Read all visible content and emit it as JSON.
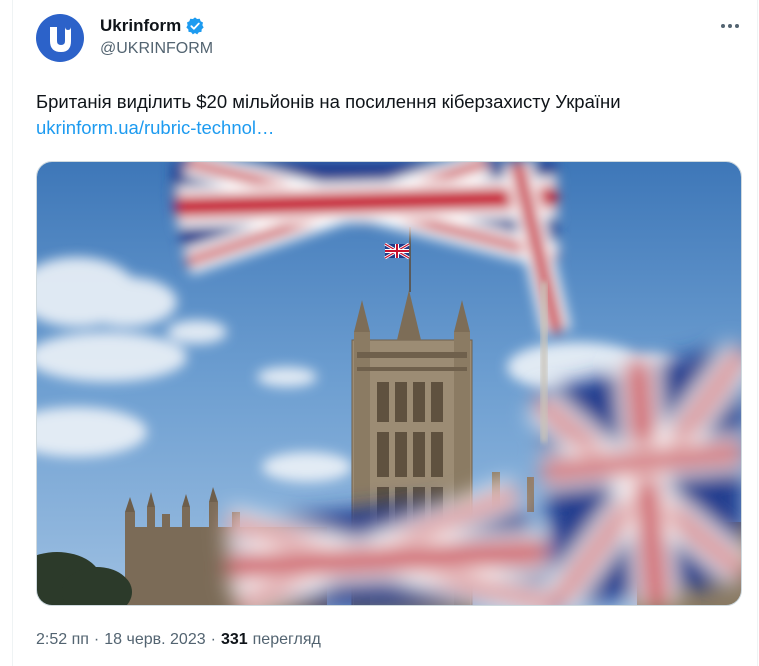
{
  "tweet": {
    "author": {
      "display_name": "Ukrinform",
      "handle": "@UKRINFORM",
      "verified": true,
      "avatar_letter": "U",
      "avatar_color": "#2c62c9"
    },
    "text": "Британія виділить $20 мільйонів на посилення кіберзахисту України",
    "link_text": "ukrinform.ua/rubric-technol…",
    "link_color": "#1d9bf0",
    "media": {
      "icon": "photo-houses-of-parliament-with-union-flags"
    },
    "meta": {
      "time": "2:52 пп",
      "separator": "·",
      "date": "18 черв. 2023",
      "views_count": "331",
      "views_label": "перегляд"
    },
    "more_icon": "more-horizontal-icon"
  }
}
